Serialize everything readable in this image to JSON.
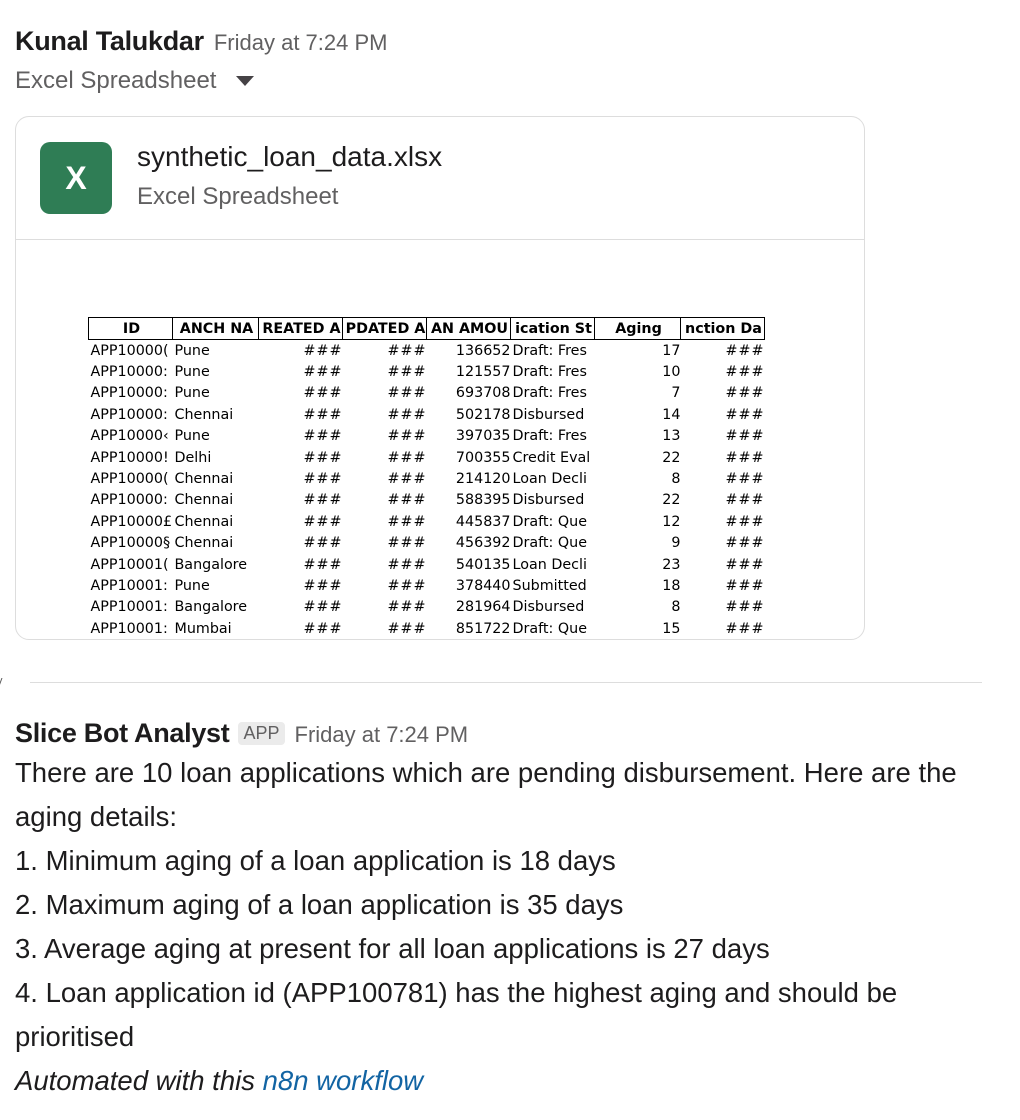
{
  "message1": {
    "author": "Kunal Talukdar",
    "time": "Friday at 7:24 PM",
    "subtitle": "Excel Spreadsheet",
    "attachment": {
      "icon_letter": "X",
      "icon_color": "#2f7d55",
      "filename": "synthetic_loan_data.xlsx",
      "filetype": "Excel Spreadsheet"
    }
  },
  "sheet": {
    "headers": [
      "ID",
      "ANCH NA",
      "REATED A",
      "PDATED A",
      "AN AMOU",
      "ication St",
      "Aging",
      "nction Da"
    ],
    "rows": [
      [
        "APP10000(",
        "Pune",
        "###",
        "###",
        "136652",
        "Draft: Fres",
        "17",
        "###"
      ],
      [
        "APP10000:",
        "Pune",
        "###",
        "###",
        "121557",
        "Draft: Fres",
        "10",
        "###"
      ],
      [
        "APP10000:",
        "Pune",
        "###",
        "###",
        "693708",
        "Draft: Fres",
        "7",
        "###"
      ],
      [
        "APP10000:",
        "Chennai",
        "###",
        "###",
        "502178",
        "Disbursed",
        "14",
        "###"
      ],
      [
        "APP10000‹",
        "Pune",
        "###",
        "###",
        "397035",
        "Draft: Fres",
        "13",
        "###"
      ],
      [
        "APP10000!",
        "Delhi",
        "###",
        "###",
        "700355",
        "Credit Eval",
        "22",
        "###"
      ],
      [
        "APP10000(",
        "Chennai",
        "###",
        "###",
        "214120",
        "Loan Decli",
        "8",
        "###"
      ],
      [
        "APP10000:",
        "Chennai",
        "###",
        "###",
        "588395",
        "Disbursed",
        "22",
        "###"
      ],
      [
        "APP10000£",
        "Chennai",
        "###",
        "###",
        "445837",
        "Draft: Que",
        "12",
        "###"
      ],
      [
        "APP10000§",
        "Chennai",
        "###",
        "###",
        "456392",
        "Draft: Que",
        "9",
        "###"
      ],
      [
        "APP10001(",
        "Bangalore",
        "###",
        "###",
        "540135",
        "Loan Decli",
        "23",
        "###"
      ],
      [
        "APP10001:",
        "Pune",
        "###",
        "###",
        "378440",
        "Submitted",
        "18",
        "###"
      ],
      [
        "APP10001:",
        "Bangalore",
        "###",
        "###",
        "281964",
        "Disbursed",
        "8",
        "###"
      ],
      [
        "APP10001:",
        "Mumbai",
        "###",
        "###",
        "851722",
        "Draft: Que",
        "15",
        "###"
      ]
    ]
  },
  "message2": {
    "author": "Slice Bot Analyst",
    "badge": "APP",
    "time": "Friday at 7:24 PM",
    "intro": "There are 10 loan applications which are pending disbursement. Here are the aging details:",
    "items": [
      "1. Minimum aging of a loan application is 18 days",
      "2. Maximum aging of a loan application is 35 days",
      "3. Average aging at present for all loan applications is 27 days",
      "4. Loan application id (APP100781) has the highest aging and should be prioritised"
    ],
    "footer_prefix": "Automated with this ",
    "footer_link": "n8n workflow",
    "link_color": "#1264a3"
  }
}
